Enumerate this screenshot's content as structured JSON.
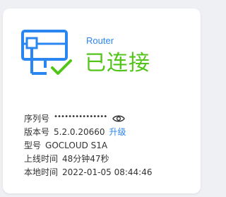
{
  "device": {
    "model_label": "Router",
    "status": "已连接",
    "icon": "router-connected-icon",
    "accent_blue": "#2a86f0",
    "status_green": "#52c41a"
  },
  "info": {
    "serial_label": "序列号",
    "serial_value": "•••••••••••••••",
    "show_serial_icon": "eye-icon",
    "version_label": "版本号",
    "version_value": "5.2.0.20660",
    "upgrade_label": "升级",
    "model_label": "型号",
    "model_value": "GOCLOUD S1A",
    "uptime_label": "上线时间",
    "uptime_value": "48分钟47秒",
    "local_time_label": "本地时间",
    "local_time_value": "2022-01-05 08:44:46"
  }
}
